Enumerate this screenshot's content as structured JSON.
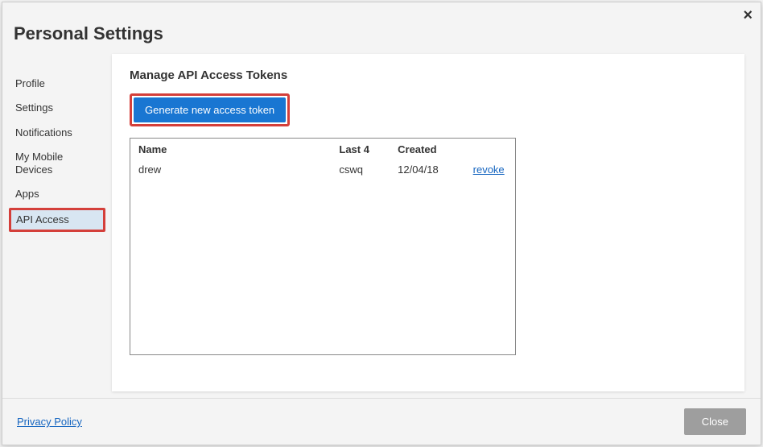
{
  "title": "Personal Settings",
  "close_x": "×",
  "sidebar": {
    "items": [
      {
        "label": "Profile"
      },
      {
        "label": "Settings"
      },
      {
        "label": "Notifications"
      },
      {
        "label": "My Mobile Devices"
      },
      {
        "label": "Apps"
      },
      {
        "label": "API Access"
      }
    ]
  },
  "panel": {
    "heading": "Manage API Access Tokens",
    "generate_label": "Generate new access token",
    "columns": {
      "name": "Name",
      "last4": "Last 4",
      "created": "Created"
    },
    "rows": [
      {
        "name": "drew",
        "last4": "cswq",
        "created": "12/04/18",
        "action": "revoke"
      }
    ]
  },
  "footer": {
    "privacy": "Privacy Policy",
    "close": "Close"
  }
}
